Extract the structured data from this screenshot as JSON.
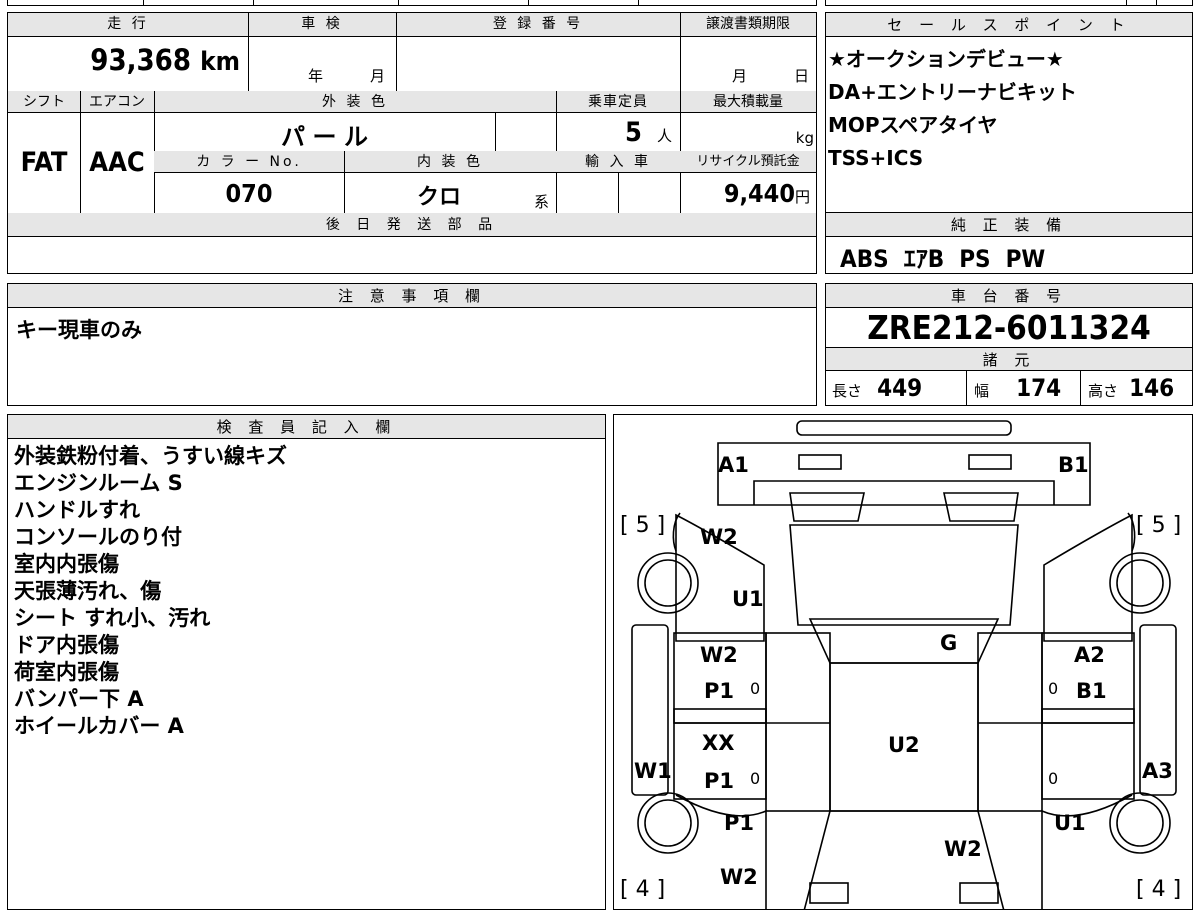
{
  "vehicle": {
    "mileage_label": "走 行",
    "mileage": "93,368",
    "mileage_unit": "km",
    "shaken_label": "車 検",
    "shaken_year_unit": "年",
    "shaken_month_unit": "月",
    "reg_label": "登 録 番 号",
    "transfer_label": "譲渡書類期限",
    "transfer_month_unit": "月",
    "transfer_day_unit": "日",
    "shift_label": "シフト",
    "shift": "FAT",
    "ac_label": "エアコン",
    "ac": "AAC",
    "exterior_label": "外 装 色",
    "exterior": "パ ー ル",
    "capacity_label": "乗車定員",
    "capacity": "5",
    "capacity_unit": "人",
    "maxload_label": "最大積載量",
    "maxload_unit": "kg",
    "color_no_label": "カ ラ ー No.",
    "color_no": "070",
    "interior_label": "内 装 色",
    "interior": "クロ",
    "interior_unit": "系",
    "import_label": "輸 入 車",
    "recycle_label": "リサイクル預託金",
    "recycle": "9,440",
    "recycle_unit": "円",
    "later_parts_label": "後 日 発 送 部 品"
  },
  "sales": {
    "label": "セ ー ル ス ポ イ ン ト",
    "points": [
      "★オークションデビュー★",
      "DA+エントリーナビキット",
      "MOPスペアタイヤ",
      "TSS+ICS"
    ]
  },
  "equipment": {
    "label": "純 正 装 備",
    "items": "ABS  ｴｱB  PS  PW"
  },
  "caution": {
    "label": "注 意 事 項 欄",
    "text": "キー現車のみ"
  },
  "chassis": {
    "label": "車 台 番 号",
    "number": "ZRE212-6011324",
    "spec_label": "諸 元",
    "length_label": "長さ",
    "length": "449",
    "width_label": "幅",
    "width": "174",
    "height_label": "高さ",
    "height": "146"
  },
  "inspector": {
    "label": "検 査 員 記 入 欄",
    "notes": [
      "外装鉄粉付着、うすい線キズ",
      "エンジンルーム S",
      "ハンドルすれ",
      "コンソールのり付",
      "室内内張傷",
      "天張薄汚れ、傷",
      "シート すれ小、汚れ",
      "ドア内張傷",
      "荷室内張傷",
      "バンパー下 A",
      "ホイールカバー A"
    ]
  },
  "diagram": {
    "tread_fl": "[ 5 ]",
    "tread_fr": "[ 5 ]",
    "tread_rl": "[ 4 ]",
    "tread_rr": "[ 4 ]",
    "labels": {
      "front_left_bumper": "A1",
      "front_right_bumper": "B1",
      "left_fender_1": "W2",
      "left_fender_2": "U1",
      "windshield": "G",
      "left_front_door_1": "W2",
      "left_front_door_2": "P1",
      "right_front_door_1": "A2",
      "right_front_door_2": "B1",
      "roof": "U2",
      "left_rear_door_1": "XX",
      "left_rear_door_2": "P1",
      "left_sill": "W1",
      "right_sill": "A3",
      "left_quarter": "P1",
      "right_quarter": "U1",
      "rear_left": "W2",
      "trunk": "W2",
      "mark_lf": "0",
      "mark_rf": "0",
      "mark_lr": "0",
      "mark_rr": "0"
    }
  }
}
